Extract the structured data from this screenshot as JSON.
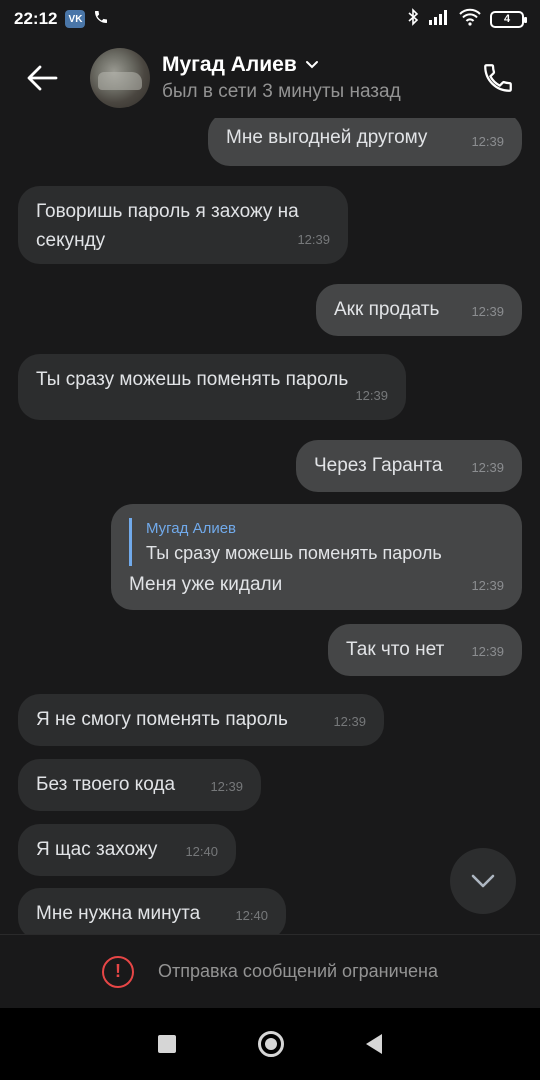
{
  "status_bar": {
    "time": "22:12",
    "vk_badge": "VK",
    "battery": "4"
  },
  "header": {
    "contact_name": "Мугад Алиев",
    "last_seen": "был в сети 3 минуты назад"
  },
  "messages": [
    {
      "dir": "out",
      "text": "Мне выгодней другому",
      "time": "12:39"
    },
    {
      "dir": "in",
      "text": "Говоришь пароль я захожу на секунду",
      "time": "12:39"
    },
    {
      "dir": "out",
      "text": "Акк продать",
      "time": "12:39"
    },
    {
      "dir": "in",
      "text": "Ты сразу можешь поменять пароль",
      "time": "12:39"
    },
    {
      "dir": "out",
      "text": "Через Гаранта",
      "time": "12:39"
    },
    {
      "dir": "out",
      "reply_name": "Мугад Алиев",
      "reply_text": "Ты сразу можешь поменять пароль",
      "text": "Меня уже кидали",
      "time": "12:39"
    },
    {
      "dir": "out",
      "text": "Так что нет",
      "time": "12:39"
    },
    {
      "dir": "in",
      "text": "Я не смогу поменять пароль",
      "time": "12:39"
    },
    {
      "dir": "in",
      "text": "Без твоего кода",
      "time": "12:39"
    },
    {
      "dir": "in",
      "text": "Я щас захожу",
      "time": "12:40"
    },
    {
      "dir": "in",
      "text": "Мне нужна минута",
      "time": "12:40"
    }
  ],
  "footer": {
    "restricted_text": "Отправка сообщений ограничена"
  },
  "colors": {
    "background": "#19191a",
    "incoming": "#2c2d2e",
    "outgoing": "#454647",
    "accent": "#71aaeb",
    "warning": "#e64646"
  }
}
